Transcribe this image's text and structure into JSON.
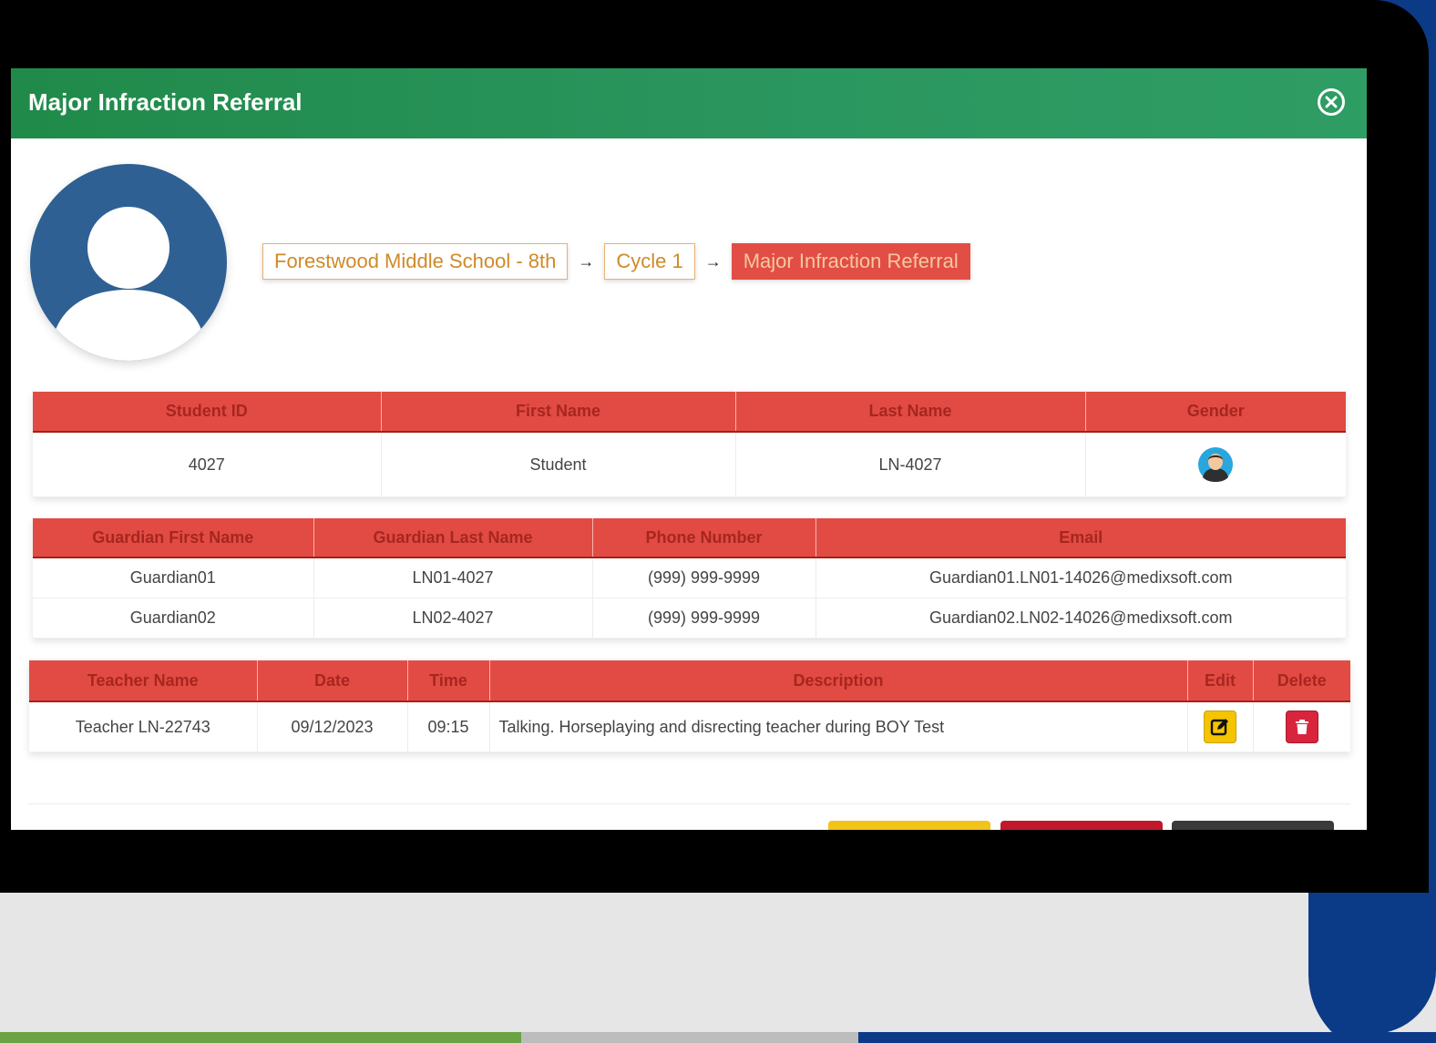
{
  "modal": {
    "title": "Major Infraction Referral"
  },
  "breadcrumb": [
    "Forestwood Middle School - 8th",
    "Cycle 1",
    "Major Infraction Referral"
  ],
  "breadcrumb_separator": "→",
  "student_table": {
    "headers": [
      "Student ID",
      "First Name",
      "Last Name",
      "Gender"
    ],
    "row": {
      "student_id": "4027",
      "first_name": "Student",
      "last_name": "LN-4027",
      "gender_icon": "male-avatar-icon"
    }
  },
  "guardian_table": {
    "headers": [
      "Guardian First Name",
      "Guardian Last Name",
      "Phone Number",
      "Email"
    ],
    "rows": [
      [
        "Guardian01",
        "LN01-4027",
        "(999) 999-9999",
        "Guardian01.LN01-14026@medixsoft.com"
      ],
      [
        "Guardian02",
        "LN02-4027",
        "(999) 999-9999",
        "Guardian02.LN02-14026@medixsoft.com"
      ]
    ]
  },
  "referral_table": {
    "headers": [
      "Teacher Name",
      "Date",
      "Time",
      "Description",
      "Edit",
      "Delete"
    ],
    "rows": [
      [
        "Teacher LN-22743",
        "09/12/2023",
        "09:15",
        "Talking. Horseplaying and disrecting teacher during BOY Test"
      ]
    ]
  },
  "colors": {
    "header_green": "#2b9760",
    "table_header_red": "#e24b43",
    "edit_yellow": "#f5c400",
    "delete_red": "#d8253d",
    "avatar_blue": "#2f6093"
  }
}
